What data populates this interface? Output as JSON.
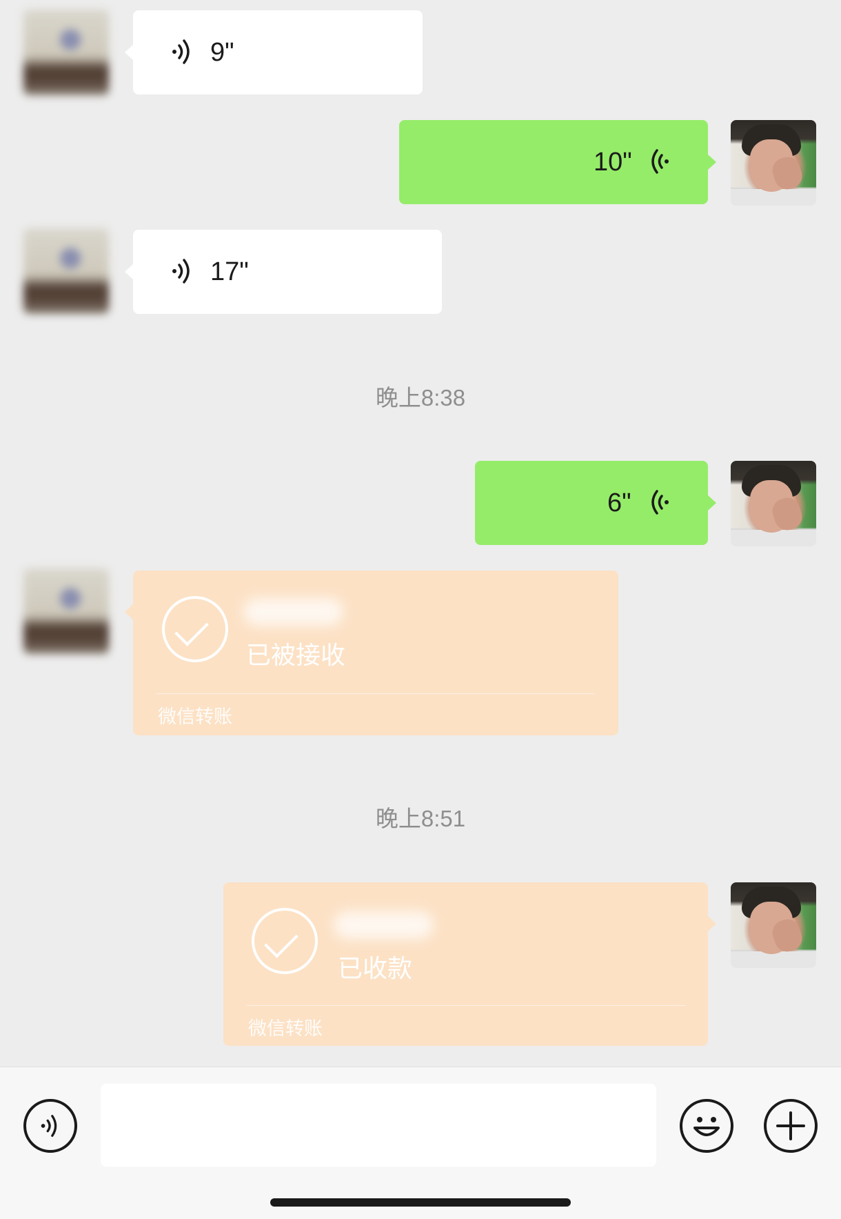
{
  "messages": {
    "m1": {
      "duration": "9\""
    },
    "m2": {
      "duration": "10\""
    },
    "m3": {
      "duration": "17\""
    },
    "time1": "晚上8:38",
    "m4": {
      "duration": "6\""
    },
    "transfer1": {
      "status": "已被接收",
      "label": "微信转账"
    },
    "time2": "晚上8:51",
    "transfer2": {
      "status": "已收款",
      "label": "微信转账"
    }
  },
  "colors": {
    "background": "#ededed",
    "sent_bubble": "#95ec69",
    "received_bubble": "#ffffff",
    "transfer_bubble": "#fce1c5"
  },
  "icons": {
    "voice_toggle": "voice-icon",
    "emoji": "emoji-icon",
    "more": "plus-icon"
  }
}
